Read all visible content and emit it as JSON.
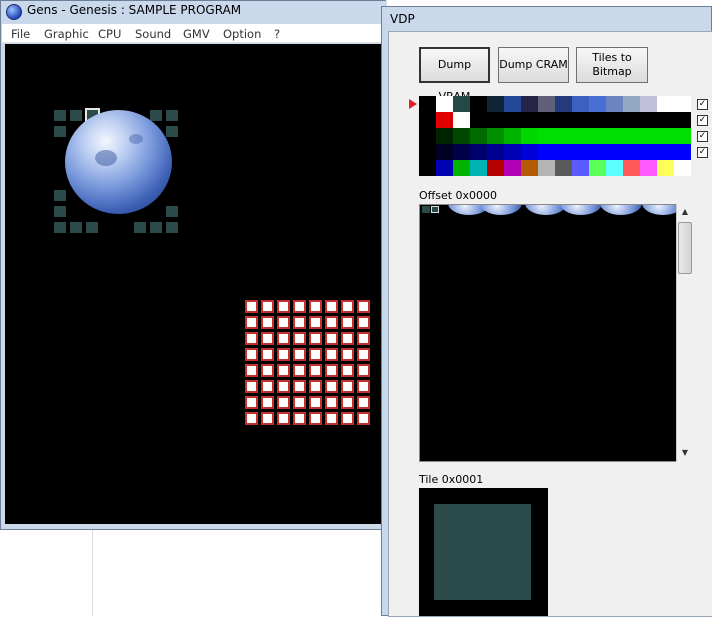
{
  "gens": {
    "title": "Gens - Genesis : SAMPLE PROGRAM",
    "menu": [
      "File",
      "Graphic",
      "CPU",
      "Sound",
      "GMV",
      "Option",
      "?"
    ]
  },
  "vdp": {
    "title": "VDP",
    "buttons": {
      "dump_vram": "Dump VRAM",
      "dump_cram": "Dump CRAM",
      "tiles_to_bitmap_line1": "Tiles to",
      "tiles_to_bitmap_line2": "Bitmap"
    },
    "palette_rows": [
      [
        "#000000",
        "#ffffff",
        "#244848",
        "#000000",
        "#102438",
        "#244898",
        "#242448",
        "#606078",
        "#243c7c",
        "#3c60c0",
        "#4870d4",
        "#6c84c0",
        "#90a8c0",
        "#c0c0dc",
        "#ffffff",
        "#ffffff"
      ],
      [
        "#000000",
        "#e00000",
        "#ffffff",
        "#000000",
        "#000000",
        "#000000",
        "#000000",
        "#000000",
        "#000000",
        "#000000",
        "#000000",
        "#000000",
        "#000000",
        "#000000",
        "#000000",
        "#000000"
      ],
      [
        "#000000",
        "#002400",
        "#004800",
        "#006c00",
        "#009000",
        "#00b400",
        "#00d800",
        "#00e000",
        "#00e000",
        "#00e000",
        "#00e000",
        "#00e000",
        "#00e000",
        "#00e000",
        "#00e000",
        "#00e000"
      ],
      [
        "#000000",
        "#000024",
        "#000048",
        "#00006c",
        "#000090",
        "#0000b4",
        "#0000d8",
        "#0000ff",
        "#0000ff",
        "#0000ff",
        "#0000ff",
        "#0000ff",
        "#0000ff",
        "#0000ff",
        "#0000ff",
        "#0000ff"
      ],
      [
        "#000000",
        "#0000b4",
        "#00b400",
        "#00b4b4",
        "#b40000",
        "#b400b4",
        "#b45a00",
        "#b4b4b4",
        "#5a5a5a",
        "#5a5aff",
        "#5aff5a",
        "#5affff",
        "#ff5a5a",
        "#ff5aff",
        "#ffff5a",
        "#ffffff"
      ]
    ],
    "palette_checks": [
      "✓",
      "✓",
      "✓",
      "✓"
    ],
    "offset_label": "Offset 0x0000",
    "tile_label": "Tile 0x0001",
    "colors": {
      "tile": "#2b4a4a",
      "cell_border": "#c23030",
      "arrow": "#e02020"
    }
  },
  "icons": {
    "app": "gens-app-icon",
    "palette_pointer": "red-arrow-icon",
    "scroll_up": "scroll-up-icon",
    "scroll_down": "scroll-down-icon"
  }
}
